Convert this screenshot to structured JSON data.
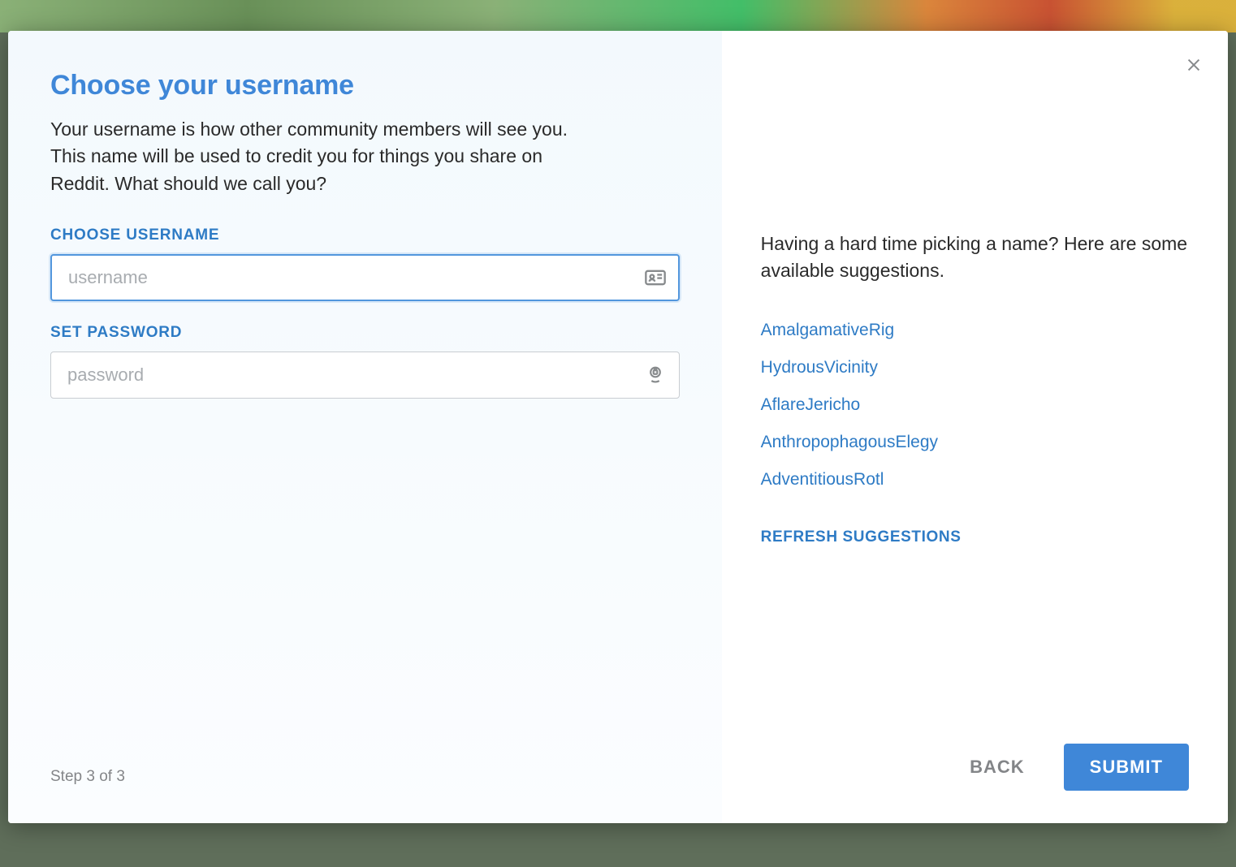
{
  "left": {
    "title": "Choose your username",
    "description": "Your username is how other community members will see you. This name will be used to credit you for things you share on Reddit. What should we call you?",
    "username_label": "CHOOSE USERNAME",
    "username_placeholder": "username",
    "username_value": "",
    "password_label": "SET PASSWORD",
    "password_placeholder": "password",
    "password_value": "",
    "step_text": "Step 3 of 3"
  },
  "right": {
    "intro": "Having a hard time picking a name? Here are some available suggestions.",
    "suggestions": [
      "AmalgamativeRig",
      "HydrousVicinity",
      "AflareJericho",
      "AnthropophagousElegy",
      "AdventitiousRotl"
    ],
    "refresh_label": "REFRESH SUGGESTIONS",
    "back_label": "BACK",
    "submit_label": "SUBMIT"
  }
}
